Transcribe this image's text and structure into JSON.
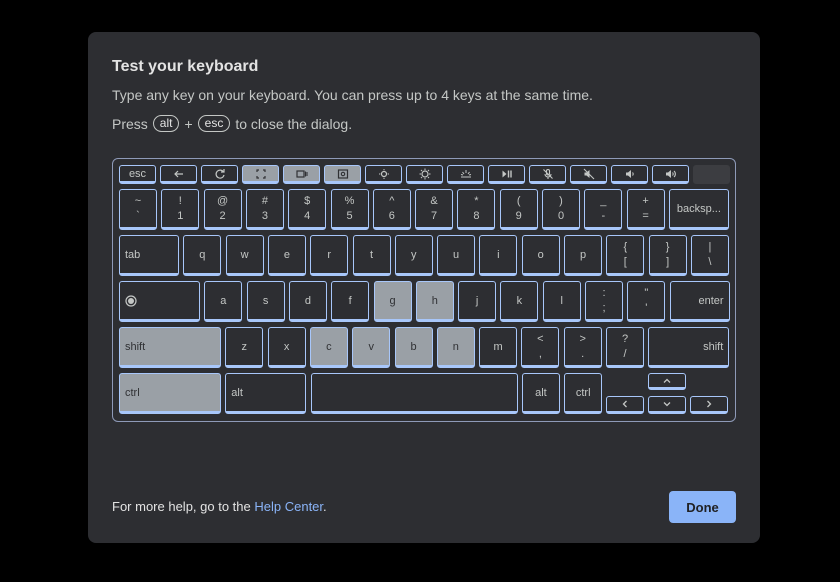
{
  "dialog": {
    "title": "Test your keyboard",
    "subtitle": "Type any key on your keyboard. You can press up to 4 keys at the same time.",
    "press_prefix": "Press",
    "press_key1": "alt",
    "press_plus": "+",
    "press_key2": "esc",
    "press_suffix": "to close the dialog.",
    "help_prefix": "For more help, go to the",
    "help_link": "Help Center",
    "help_suffix": ".",
    "done_label": "Done"
  },
  "keyboard": {
    "top_row": [
      {
        "label": "esc"
      },
      {
        "icon": "back-arrow-icon"
      },
      {
        "icon": "refresh-icon"
      },
      {
        "icon": "fullscreen-icon",
        "selected": true
      },
      {
        "icon": "overview-icon",
        "selected": true
      },
      {
        "icon": "screenshot-icon",
        "selected": true
      },
      {
        "icon": "brightness-down-icon"
      },
      {
        "icon": "brightness-up-icon"
      },
      {
        "icon": "keyboard-backlight-icon"
      },
      {
        "icon": "play-pause-icon"
      },
      {
        "icon": "mic-mute-icon"
      },
      {
        "icon": "volume-mute-icon"
      },
      {
        "icon": "volume-down-icon"
      },
      {
        "icon": "volume-up-icon"
      }
    ],
    "number_row": [
      {
        "top": "~",
        "bottom": "`"
      },
      {
        "top": "!",
        "bottom": "1"
      },
      {
        "top": "@",
        "bottom": "2"
      },
      {
        "top": "#",
        "bottom": "3"
      },
      {
        "top": "$",
        "bottom": "4"
      },
      {
        "top": "%",
        "bottom": "5"
      },
      {
        "top": "^",
        "bottom": "6"
      },
      {
        "top": "&",
        "bottom": "7"
      },
      {
        "top": "*",
        "bottom": "8"
      },
      {
        "top": "(",
        "bottom": "9"
      },
      {
        "top": ")",
        "bottom": "0"
      },
      {
        "top": "_",
        "bottom": "-"
      },
      {
        "top": "+",
        "bottom": "="
      },
      {
        "label": "backsp..."
      }
    ],
    "qwerty_row": [
      {
        "label": "tab"
      },
      {
        "label": "q"
      },
      {
        "label": "w"
      },
      {
        "label": "e"
      },
      {
        "label": "r"
      },
      {
        "label": "t"
      },
      {
        "label": "y"
      },
      {
        "label": "u"
      },
      {
        "label": "i"
      },
      {
        "label": "o"
      },
      {
        "label": "p"
      },
      {
        "top": "{",
        "bottom": "["
      },
      {
        "top": "}",
        "bottom": "]"
      },
      {
        "top": "|",
        "bottom": "\\"
      }
    ],
    "home_row": [
      {
        "icon": "launcher-icon"
      },
      {
        "label": "a"
      },
      {
        "label": "s"
      },
      {
        "label": "d"
      },
      {
        "label": "f"
      },
      {
        "label": "g",
        "selected": true
      },
      {
        "label": "h",
        "selected": true
      },
      {
        "label": "j"
      },
      {
        "label": "k"
      },
      {
        "label": "l"
      },
      {
        "top": ":",
        "bottom": ";"
      },
      {
        "top": "\"",
        "bottom": "'"
      },
      {
        "label": "enter"
      }
    ],
    "shift_row": [
      {
        "label": "shift",
        "selected": true
      },
      {
        "label": "z"
      },
      {
        "label": "x"
      },
      {
        "label": "c",
        "selected": true
      },
      {
        "label": "v",
        "selected": true
      },
      {
        "label": "b",
        "selected": true
      },
      {
        "label": "n",
        "selected": true
      },
      {
        "label": "m"
      },
      {
        "top": "<",
        "bottom": ","
      },
      {
        "top": ">",
        "bottom": "."
      },
      {
        "top": "?",
        "bottom": "/"
      },
      {
        "label": "shift"
      }
    ],
    "bottom_row": [
      {
        "label": "ctrl",
        "selected": true
      },
      {
        "label": "alt"
      },
      {
        "label": ""
      },
      {
        "label": "alt"
      },
      {
        "label": "ctrl"
      }
    ]
  },
  "colors": {
    "dialog_bg": "#2d2e32",
    "key_border": "#a8c7fa",
    "key_selected": "#9aa0a6",
    "accent": "#8ab4f8"
  }
}
